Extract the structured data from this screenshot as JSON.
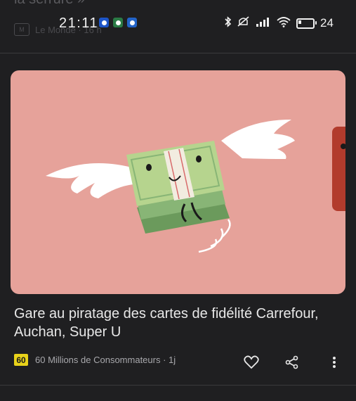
{
  "previous_card": {
    "title_fragment": "la serrure »",
    "source": "Le Monde · 16 h"
  },
  "status_bar": {
    "time": "21:11",
    "battery_level": "24",
    "notification_icons": [
      "google-icon",
      "app-icon",
      "app-icon"
    ],
    "system_icons": [
      "bluetooth-icon",
      "mute-icon",
      "signal-icon",
      "wifi-icon",
      "battery-icon"
    ]
  },
  "article": {
    "headline": "Gare au piratage des cartes de fidélité Carrefour, Auchan, Super U",
    "source_logo_text": "60",
    "source_meta": "60 Millions de Consommateurs · 1j",
    "image_description_icon": "flying-money-illustration"
  },
  "colors": {
    "background": "#1f1f21",
    "image_bg": "#e6a29a",
    "source_logo_bg": "#e8d21a"
  }
}
